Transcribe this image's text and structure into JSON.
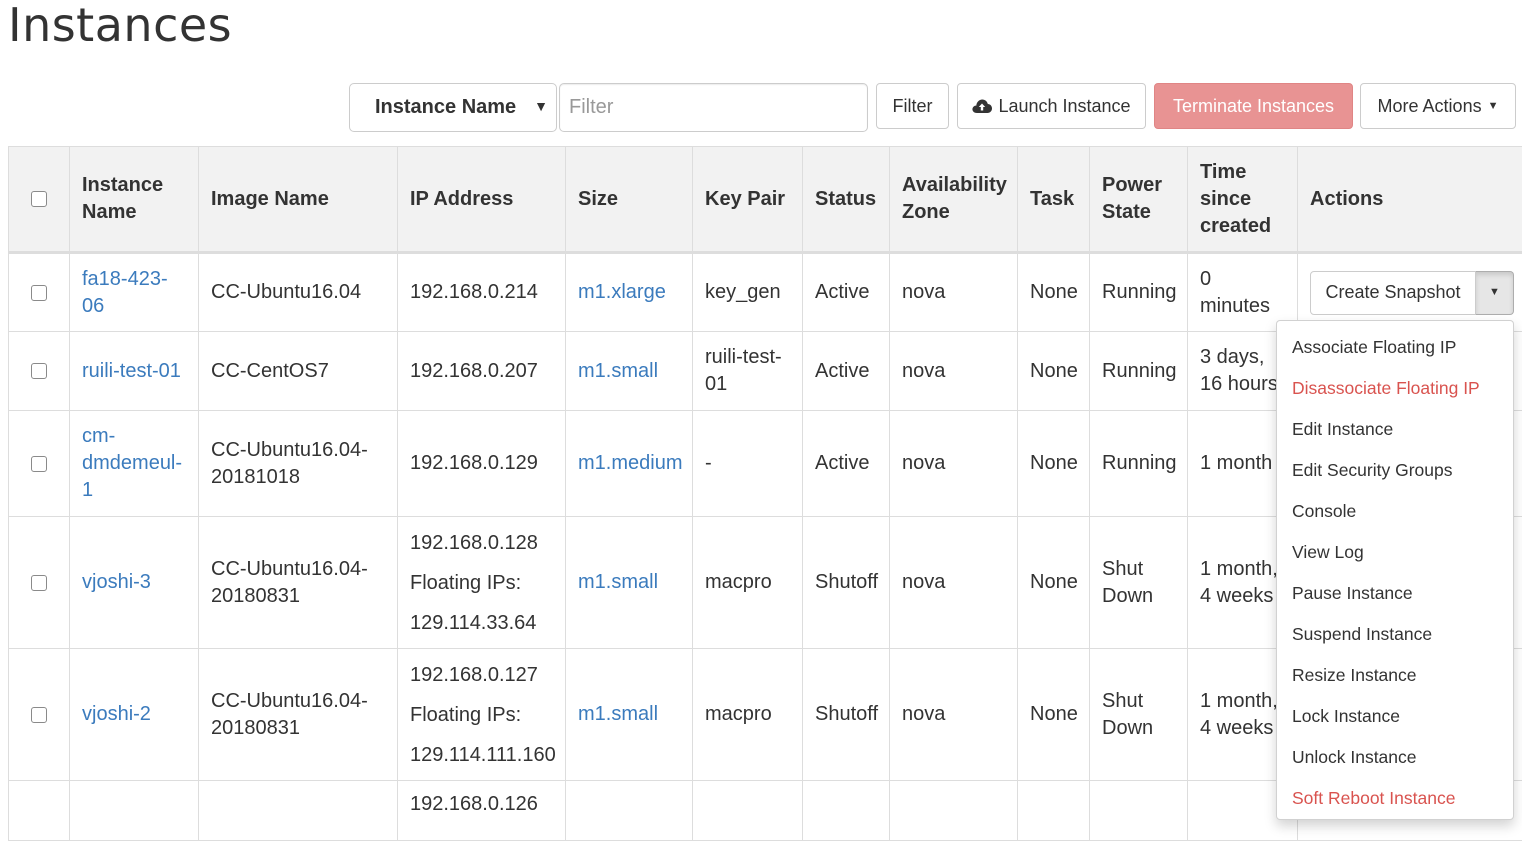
{
  "page": {
    "title": "Instances"
  },
  "toolbar": {
    "filter_field": "Instance Name",
    "filter_placeholder": "Filter",
    "filter_button": "Filter",
    "launch_button": "Launch Instance",
    "terminate_button": "Terminate Instances",
    "more_actions_button": "More Actions",
    "colors": {
      "terminate_bg": "#e89393"
    }
  },
  "table": {
    "columns": [
      "Instance Name",
      "Image Name",
      "IP Address",
      "Size",
      "Key Pair",
      "Status",
      "Availability Zone",
      "Task",
      "Power State",
      "Time since created",
      "Actions"
    ],
    "rows": [
      {
        "name": "fa18-423-06",
        "image": "CC-Ubuntu16.04",
        "ip": "192.168.0.214",
        "floating_label": "",
        "floating_ip": "",
        "size": "m1.xlarge",
        "key_pair": "key_gen",
        "status": "Active",
        "zone": "nova",
        "task": "None",
        "power": "Running",
        "time": "0 minutes",
        "action": "Create Snapshot"
      },
      {
        "name": "ruili-test-01",
        "image": "CC-CentOS7",
        "ip": "192.168.0.207",
        "floating_label": "",
        "floating_ip": "",
        "size": "m1.small",
        "key_pair": "ruili-test-01",
        "status": "Active",
        "zone": "nova",
        "task": "None",
        "power": "Running",
        "time": "3 days, 16 hours",
        "action": ""
      },
      {
        "name": "cm-dmdemeul-1",
        "image": "CC-Ubuntu16.04-20181018",
        "ip": "192.168.0.129",
        "floating_label": "",
        "floating_ip": "",
        "size": "m1.medium",
        "key_pair": "-",
        "status": "Active",
        "zone": "nova",
        "task": "None",
        "power": "Running",
        "time": "1 month",
        "action": ""
      },
      {
        "name": "vjoshi-3",
        "image": "CC-Ubuntu16.04-20180831",
        "ip": "192.168.0.128",
        "floating_label": "Floating IPs:",
        "floating_ip": "129.114.33.64",
        "size": "m1.small",
        "key_pair": "macpro",
        "status": "Shutoff",
        "zone": "nova",
        "task": "None",
        "power": "Shut Down",
        "time": "1 month, 4 weeks",
        "action": ""
      },
      {
        "name": "vjoshi-2",
        "image": "CC-Ubuntu16.04-20180831",
        "ip": "192.168.0.127",
        "floating_label": "Floating IPs:",
        "floating_ip": "129.114.111.160",
        "size": "m1.small",
        "key_pair": "macpro",
        "status": "Shutoff",
        "zone": "nova",
        "task": "None",
        "power": "Shut Down",
        "time": "1 month, 4 weeks",
        "action": ""
      },
      {
        "name": "",
        "image": "",
        "ip": "192.168.0.126",
        "floating_label": "",
        "floating_ip": "",
        "size": "",
        "key_pair": "",
        "status": "",
        "zone": "",
        "task": "",
        "power": "",
        "time": "",
        "action": ""
      }
    ]
  },
  "action_menu": {
    "items": [
      {
        "label": "Associate Floating IP",
        "danger": false
      },
      {
        "label": "Disassociate Floating IP",
        "danger": true
      },
      {
        "label": "Edit Instance",
        "danger": false
      },
      {
        "label": "Edit Security Groups",
        "danger": false
      },
      {
        "label": "Console",
        "danger": false
      },
      {
        "label": "View Log",
        "danger": false
      },
      {
        "label": "Pause Instance",
        "danger": false
      },
      {
        "label": "Suspend Instance",
        "danger": false
      },
      {
        "label": "Resize Instance",
        "danger": false
      },
      {
        "label": "Lock Instance",
        "danger": false
      },
      {
        "label": "Unlock Instance",
        "danger": false
      },
      {
        "label": "Soft Reboot Instance",
        "danger": true
      }
    ]
  }
}
